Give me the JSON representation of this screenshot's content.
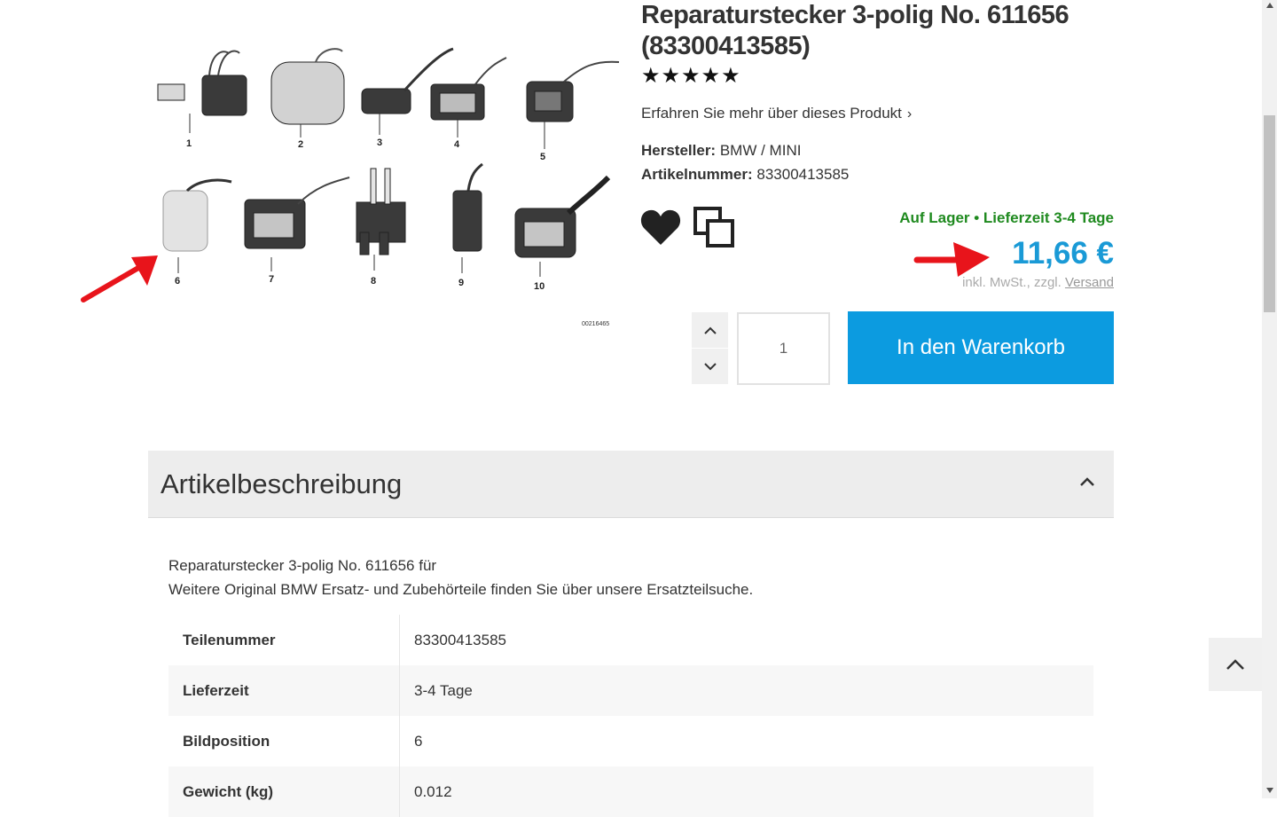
{
  "product": {
    "title": "Reparaturstecker 3-polig No. 611656 (83300413585)",
    "rating_stars": "★★★★★",
    "rating_value": 5,
    "learn_more": "Erfahren Sie mehr über dieses Produkt",
    "manufacturer_label": "Hersteller:",
    "manufacturer": "BMW / MINI",
    "article_label": "Artikelnummer:",
    "article_number": "83300413585",
    "stock": "Auf Lager • Lieferzeit 3-4 Tage",
    "price": "11,66 €",
    "vat_prefix": "inkl. MwSt., zzgl.",
    "shipping_link": "Versand",
    "quantity": "1",
    "add_to_cart": "In den Warenkorb"
  },
  "image": {
    "part_numbers": [
      "1",
      "2",
      "3",
      "4",
      "5",
      "6",
      "7",
      "8",
      "9",
      "10"
    ],
    "code": "00216465"
  },
  "description": {
    "heading": "Artikelbeschreibung",
    "line1": "Reparaturstecker 3-polig No. 611656 für",
    "line2": "Weitere Original BMW Ersatz- und Zubehörteile finden Sie über unsere Ersatzteilsuche.",
    "specs": [
      {
        "key": "Teilenummer",
        "value": "83300413585"
      },
      {
        "key": "Lieferzeit",
        "value": "3-4 Tage"
      },
      {
        "key": "Bildposition",
        "value": "6"
      },
      {
        "key": "Gewicht (kg)",
        "value": "0.012"
      }
    ]
  },
  "colors": {
    "price": "#1a9ad6",
    "stock": "#1f8a1f",
    "cart_button": "#0c9be0",
    "annotation_arrow": "#e8141b"
  },
  "icons": [
    "heart-icon",
    "compare-icon",
    "chevron-up-icon",
    "chevron-down-icon",
    "chevron-right-icon",
    "arrow-annotation-icon"
  ]
}
